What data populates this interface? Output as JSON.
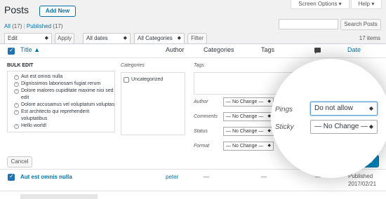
{
  "page": {
    "title": "Posts",
    "add_new": "Add New"
  },
  "screen_tabs": {
    "screen_options": "Screen Options ▾",
    "help": "Help ▾"
  },
  "filters": {
    "all": "All",
    "all_count": "(17)",
    "sep": "|",
    "published": "Published",
    "published_count": "(17)"
  },
  "search": {
    "placeholder": "",
    "button": "Search Posts"
  },
  "toolbar": {
    "bulk_action": "Edit",
    "apply": "Apply",
    "dates": "All dates",
    "categories": "All Categories",
    "filter": "Filter",
    "items": "17 items"
  },
  "columns": {
    "title": "Title ▲",
    "author": "Author",
    "categories": "Categories",
    "tags": "Tags",
    "comments_icon": "speech-bubble-icon",
    "date": "Date"
  },
  "bulk_edit": {
    "heading": "BULK EDIT",
    "posts": [
      "Aut est omnis nulla",
      "Dignissimos laboriosam fugiat rerum",
      "Dolore malores cupiditate maxime nisi sed",
      "edit",
      "Dolore accusamus vel voluptatum voluptas",
      "Est architecto qui reprehenderit",
      "voluptatibus",
      "Hello world!"
    ],
    "categories_label": "Categories",
    "uncategorized": "Uncategorized",
    "tags_label": "Tags",
    "fields": [
      {
        "label": "Author",
        "value": "— No Change —"
      },
      {
        "label": "Comments",
        "value": "— No Change —"
      },
      {
        "label": "Status",
        "value": "— No Change —"
      },
      {
        "label": "Format",
        "value": "— No Change —"
      }
    ],
    "pings_label": "Pings",
    "pings_value": "Do not allow",
    "sticky_label": "Sticky",
    "sticky_value": "— No Change —",
    "cancel": "Cancel",
    "update": "Update"
  },
  "row": {
    "title": "Aut est omnis nulla",
    "author": "peter",
    "categories": "—",
    "tags": "—",
    "comments": "—",
    "status": "Published",
    "date": "2017/02/21"
  },
  "colors": {
    "link": "#0073aa",
    "accent": "#2271b1"
  }
}
